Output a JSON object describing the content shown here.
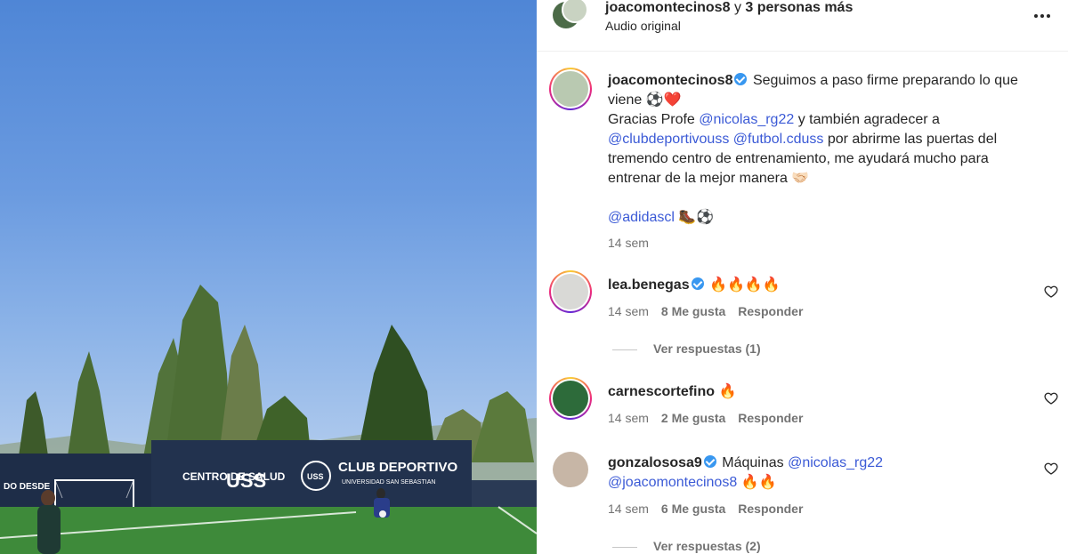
{
  "header": {
    "username": "joacomontecinos8",
    "connector": "y",
    "others": "3 personas más",
    "subtitle": "Audio original"
  },
  "caption": {
    "username": "joacomontecinos8",
    "text_1": "Seguimos a paso firme preparando lo que viene ⚽❤️",
    "text_2": "Gracias Profe",
    "mention_1": "@nicolas_rg22",
    "text_3": "y también agradecer a",
    "mention_2": "@clubdeportivouss",
    "mention_3": "@futbol.cduss",
    "text_4": "por abrirme las puertas del tremendo centro de entrenamiento, me ayudará mucho para entrenar de la mejor manera 🤝🏻",
    "mention_4": "@adidascl",
    "emoji_tail": "🥾⚽",
    "time": "14 sem"
  },
  "comments": [
    {
      "username": "lea.benegas",
      "verified": true,
      "text": "🔥🔥🔥🔥",
      "time": "14 sem",
      "likes": "8 Me gusta",
      "reply": "Responder",
      "view_replies": "Ver respuestas (1)"
    },
    {
      "username": "carnescortefino",
      "verified": false,
      "text": "🔥",
      "time": "14 sem",
      "likes": "2 Me gusta",
      "reply": "Responder"
    },
    {
      "username": "gonzalososa9",
      "verified": true,
      "text": "Máquinas",
      "mention_1": "@nicolas_rg22",
      "mention_2": "@joacomontecinos8",
      "text_tail": "🔥🔥",
      "time": "14 sem",
      "likes": "6 Me gusta",
      "reply": "Responder",
      "view_replies": "Ver respuestas (2)"
    }
  ],
  "media": {
    "banner_left": "DO DESDE",
    "banner_centro": "CENTRO DE SALUD",
    "banner_uss": "USS",
    "banner_club": "CLUB DEPORTIVO",
    "banner_club_sub": "UNIVERSIDAD SAN SEBASTIAN"
  },
  "colors": {
    "link": "#3b5ad6",
    "verified": "#3897f0",
    "muted": "#737373"
  }
}
